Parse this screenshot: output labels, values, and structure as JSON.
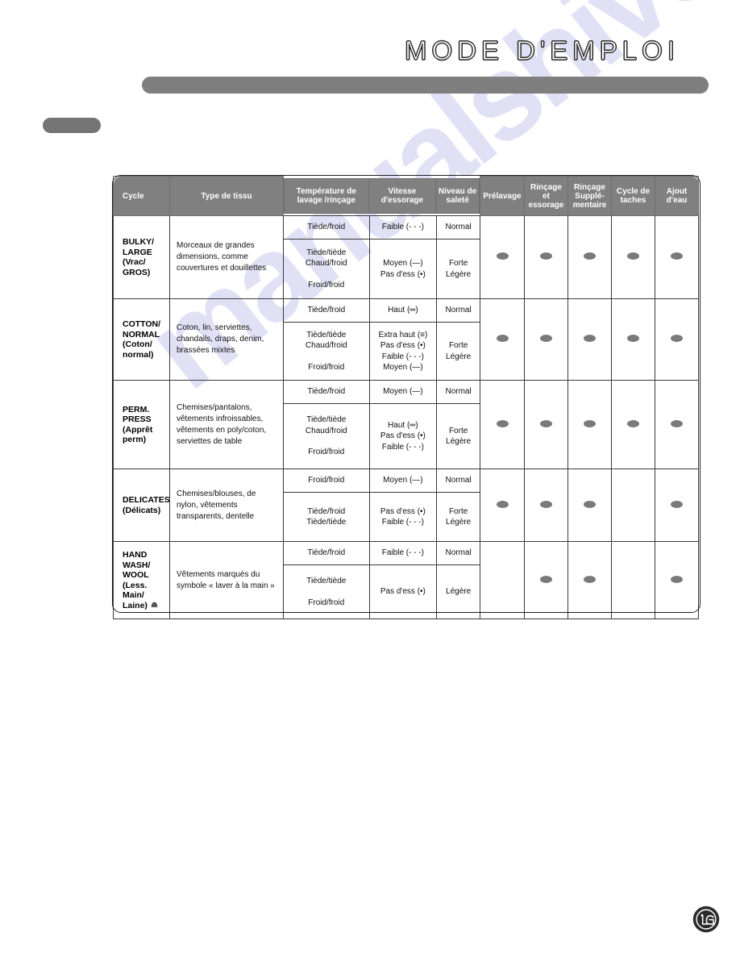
{
  "page": {
    "manual_title": "MODE D'EMPLOI",
    "watermark": "manualshive.com",
    "brand": "LG"
  },
  "table": {
    "headers": [
      "Cycle",
      "Type de tissu",
      "Température de lavage /rinçage",
      "Vitesse d'essorage",
      "Niveau de saleté",
      "Prélavage",
      "Rinçage et essorage",
      "Rinçage Supplé- mentaire",
      "Cycle de taches",
      "Ajout d'eau"
    ],
    "headers_short": {
      "cycle": "Cycle",
      "fabric": "Type de tissu",
      "temp_l1": "Température de",
      "temp_l2": "lavage /rinçage",
      "spin_l1": "Vitesse",
      "spin_l2": "d'essorage",
      "soil_l1": "Niveau de",
      "soil_l2": "saleté",
      "prewash": "Prélavage",
      "rinse_l1": "Rinçage et",
      "rinse_l2": "essorage",
      "extrarinse_l1": "Rinçage",
      "extrarinse_l2": "Supplé-",
      "extrarinse_l3": "mentaire",
      "stain_l1": "Cycle de",
      "stain_l2": "taches",
      "water_l1": "Ajout d'eau"
    },
    "rows": [
      {
        "cycle": "BULKY/ LARGE (Vrac/ GROS)",
        "cycle_lines": [
          "BULKY/",
          "LARGE",
          "(Vrac/",
          "GROS)"
        ],
        "fabric": "Morceaux de grandes dimensions, comme couvertures et douillettes",
        "top": {
          "temp": [
            "Tiède/froid"
          ],
          "spin": [
            "Faible (- - -)"
          ],
          "soil": [
            "Normal"
          ]
        },
        "bottom": {
          "temp": [
            "Tiède/tiède",
            "Chaud/froid",
            "",
            "Froid/froid"
          ],
          "spin": [
            "Moyen (—)",
            "Pas d'ess (•)"
          ],
          "soil": [
            "Forte",
            "Légère"
          ]
        },
        "options": {
          "prewash": true,
          "rinse": true,
          "extra_rinse": true,
          "stain": true,
          "water": true
        }
      },
      {
        "cycle": "COTTON/ NORMAL (Coton/ normal)",
        "cycle_lines": [
          "COTTON/",
          "NORMAL",
          "(Coton/",
          "normal)"
        ],
        "fabric": "Coton, lin, serviettes, chandails, draps, denim, brassées mixtes",
        "top": {
          "temp": [
            "Tiède/froid"
          ],
          "spin": [
            "Haut (═)"
          ],
          "soil": [
            "Normal"
          ]
        },
        "bottom": {
          "temp": [
            "Tiède/tiède",
            "Chaud/froid",
            "",
            "Froid/froid"
          ],
          "spin": [
            "Extra haut (≡)",
            "Pas d'ess (•)",
            "Faible (- - -)",
            "Moyen (—)"
          ],
          "soil": [
            "Forte",
            "Légère"
          ]
        },
        "options": {
          "prewash": true,
          "rinse": true,
          "extra_rinse": true,
          "stain": true,
          "water": true
        }
      },
      {
        "cycle": "PERM. PRESS (Apprêt perm)",
        "cycle_lines": [
          "PERM.",
          "PRESS",
          "(Apprêt",
          "perm)"
        ],
        "fabric": "Chemises/pantalons, vêtements infroissables, vêtements en poly/coton, serviettes de table",
        "top": {
          "temp": [
            "Tiède/froid"
          ],
          "spin": [
            "Moyen (—)"
          ],
          "soil": [
            "Normal"
          ]
        },
        "bottom": {
          "temp": [
            "Tiède/tiède",
            "Chaud/froid",
            "",
            "Froid/froid"
          ],
          "spin": [
            "Haut (═)",
            "Pas d'ess (•)",
            "Faible (- - -)"
          ],
          "soil": [
            "Forte",
            "Légère"
          ]
        },
        "options": {
          "prewash": true,
          "rinse": true,
          "extra_rinse": true,
          "stain": true,
          "water": true
        }
      },
      {
        "cycle": "DELICATES (Délicats)",
        "cycle_lines": [
          "DELICATES",
          "(Délicats)"
        ],
        "fabric": "Chemises/blouses, de nylon, vêtements transparents, dentelle",
        "top": {
          "temp": [
            "Froid/froid"
          ],
          "spin": [
            "Moyen (—)"
          ],
          "soil": [
            "Normal"
          ]
        },
        "bottom": {
          "temp": [
            "Tiède/froid",
            "Tiède/tiède"
          ],
          "spin": [
            "Pas d'ess (•)",
            "Faible (- - -)"
          ],
          "soil": [
            "Forte",
            "Légère"
          ]
        },
        "options": {
          "prewash": true,
          "rinse": true,
          "extra_rinse": true,
          "stain": false,
          "water": true
        }
      },
      {
        "cycle": "HAND WASH/ WOOL (Less. Main/ Laine)",
        "cycle_lines": [
          "HAND WASH/",
          "WOOL",
          "(Less. Main/",
          "Laine)"
        ],
        "fabric": "Vêtements marqués du symbole « laver à la main »",
        "top": {
          "temp": [
            "Tiède/froid"
          ],
          "spin": [
            "Faible (- - -)"
          ],
          "soil": [
            "Normal"
          ]
        },
        "bottom": {
          "temp": [
            "Tiède/tiède",
            "",
            "Froid/froid"
          ],
          "spin": [
            "Pas d'ess (•)"
          ],
          "soil": [
            "Légère"
          ]
        },
        "options": {
          "prewash": false,
          "rinse": true,
          "extra_rinse": true,
          "stain": false,
          "water": true
        }
      }
    ]
  },
  "colors": {
    "header_gray": "#808080",
    "bar_gray": "#7f7f7f",
    "dot_gray": "#7a7a7a",
    "border": "#3a3a3a"
  }
}
